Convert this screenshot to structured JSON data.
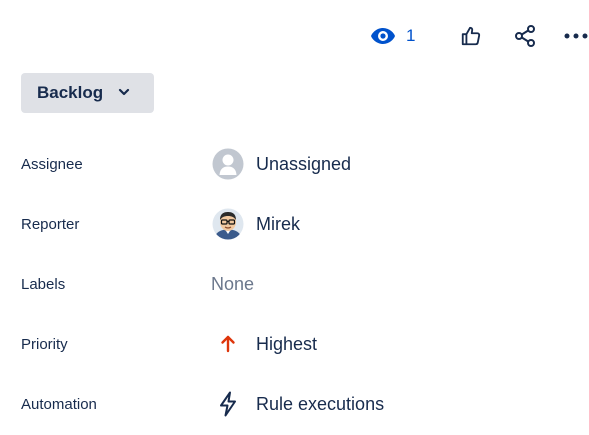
{
  "header": {
    "watchers": "1",
    "icons": [
      "eye-icon",
      "thumbs-up-icon",
      "share-icon",
      "more-icon"
    ],
    "accent_color": "#0052cc"
  },
  "status": {
    "label": "Backlog",
    "background": "#dfe1e6"
  },
  "fields": {
    "assignee": {
      "label": "Assignee",
      "value": "Unassigned"
    },
    "reporter": {
      "label": "Reporter",
      "value": "Mirek"
    },
    "labels": {
      "label": "Labels",
      "value": "None"
    },
    "priority": {
      "label": "Priority",
      "value": "Highest",
      "icon_color": "#de350b"
    },
    "automation": {
      "label": "Automation",
      "value": "Rule executions"
    }
  }
}
